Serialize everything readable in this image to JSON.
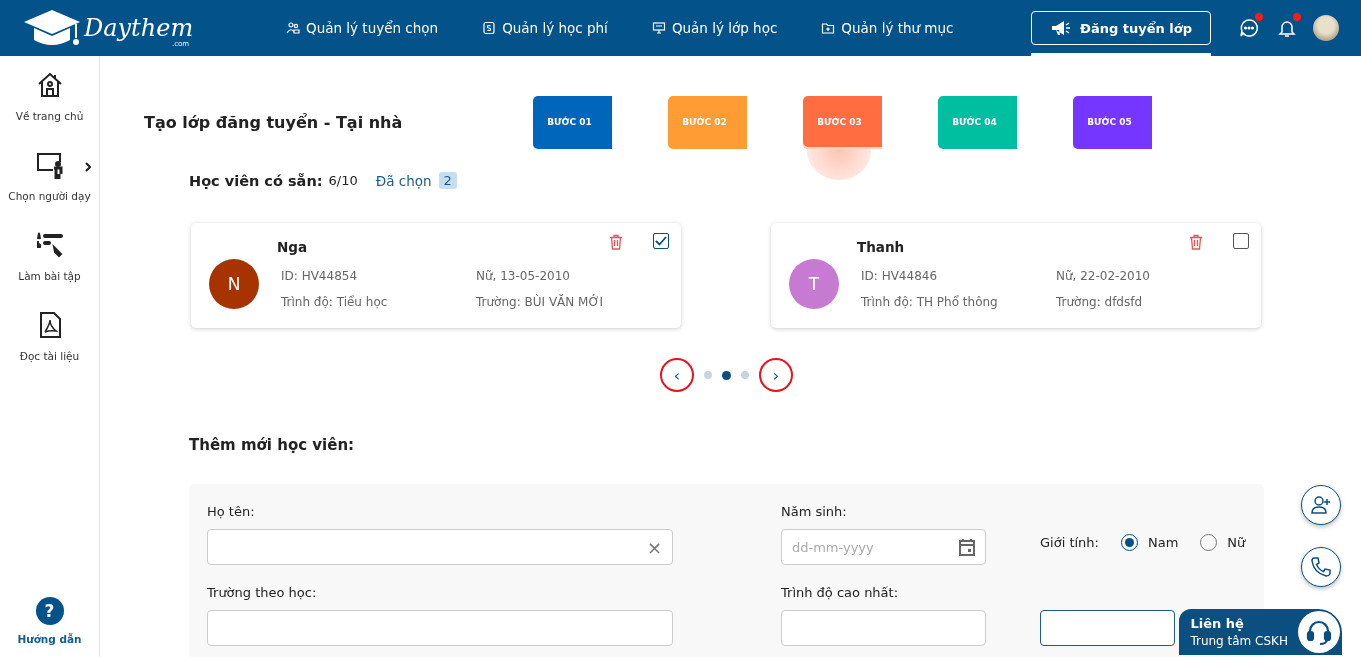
{
  "header": {
    "logo": {
      "name": "Daythem",
      "suffix": ".com"
    },
    "nav": [
      {
        "label": "Quản lý tuyển chọn"
      },
      {
        "label": "Quản lý học phí"
      },
      {
        "label": "Quản lý lớp học"
      },
      {
        "label": "Quản lý thư mục"
      }
    ],
    "post_button": {
      "label": "Đăng tuyển lớp",
      "selected": true
    },
    "chat": {
      "unread": true
    },
    "notifications": {
      "unread": true
    }
  },
  "sidebar": {
    "items": [
      {
        "label": "Về trang chủ",
        "expandable": false
      },
      {
        "label": "Chọn người dạy",
        "expandable": true
      },
      {
        "label": "Làm bài tập",
        "expandable": false
      },
      {
        "label": "Đọc tài liệu",
        "expandable": false
      }
    ],
    "help": {
      "icon_text": "?",
      "label": "Hướng dẫn"
    }
  },
  "page": {
    "title": "Tạo lớp đăng tuyển - Tại nhà",
    "steps": [
      {
        "label": "BƯỚC 01",
        "color": "#0066bb",
        "selected": false
      },
      {
        "label": "BƯỚC 02",
        "color": "#ff9c33",
        "selected": false
      },
      {
        "label": "BƯỚC 03",
        "color": "#ff6d40",
        "selected": true
      },
      {
        "label": "BƯỚC 04",
        "color": "#00bfa0",
        "selected": false
      },
      {
        "label": "BƯỚC 05",
        "color": "#7537ff",
        "selected": false
      }
    ]
  },
  "students": {
    "label": "Học viên có sẵn:",
    "count": "6/10",
    "selected_label": "Đã chọn",
    "selected_count": "2",
    "cards": [
      {
        "initial": "N",
        "color": "#a63300",
        "name": "Nga",
        "id": "ID: HV44854",
        "gender_dob": "Nữ, 13-05-2010",
        "level": "Trình độ: Tiểu học",
        "school": "Trường: BÙI VĂN MỚI",
        "checked": true
      },
      {
        "initial": "T",
        "color": "#c77ad2",
        "name": "Thanh",
        "id": "ID: HV44846",
        "gender_dob": "Nữ, 22-02-2010",
        "level": "Trình độ: TH Phổ thông",
        "school": "Trường: dfdsfd",
        "checked": false
      }
    ],
    "pager": {
      "prev": "‹",
      "next": "›",
      "dots": [
        {
          "selected": false
        },
        {
          "selected": true
        },
        {
          "selected": false
        }
      ],
      "highlighted": true
    }
  },
  "new_student": {
    "title": "Thêm mới học viên:",
    "name_label": "Họ tên:",
    "name_clear": "×",
    "birth_label": "Năm sinh:",
    "birth_placeholder": "dd-mm-yyyy",
    "gender_label": "Giới tính:",
    "genders": [
      {
        "label": "Nam",
        "selected": true
      },
      {
        "label": "Nữ",
        "selected": false
      }
    ],
    "school_label": "Trường theo học:",
    "level_label": "Trình độ cao nhất:"
  },
  "contact": {
    "title": "Liên hệ",
    "subtitle": "Trung tâm CSKH"
  }
}
